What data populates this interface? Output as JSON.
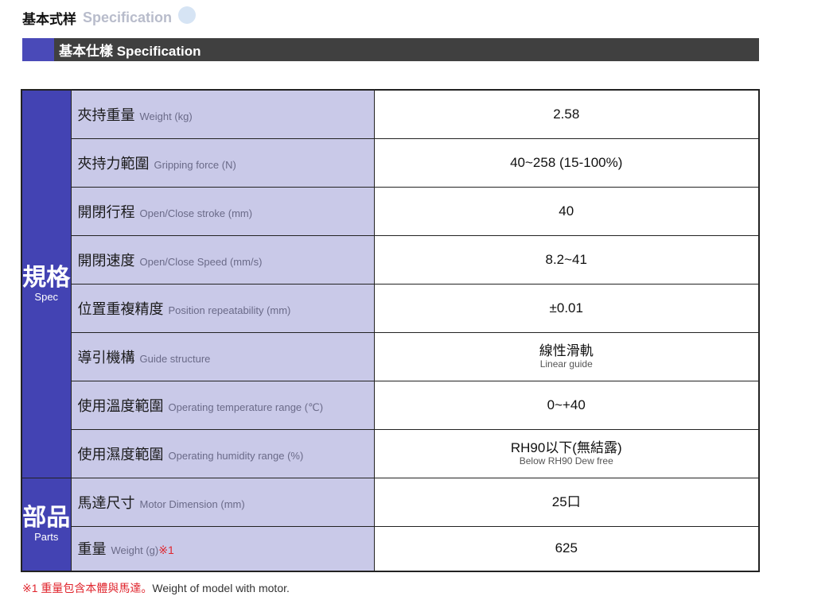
{
  "heading": {
    "zh": "基本式样",
    "en": "Specification"
  },
  "banner": {
    "title": "基本仕樣 Specification"
  },
  "sections": {
    "spec": {
      "zh": "規格",
      "en": "Spec"
    },
    "parts": {
      "zh": "部品",
      "en": "Parts"
    }
  },
  "rows": [
    {
      "label_zh": "夾持重量",
      "label_en": "Weight (kg)",
      "value": "2.58"
    },
    {
      "label_zh": "夾持力範圍",
      "label_en": "Gripping force (N)",
      "value": "40~258 (15-100%)"
    },
    {
      "label_zh": "開閉行程",
      "label_en": "Open/Close  stroke (mm)",
      "value": "40"
    },
    {
      "label_zh": "開閉速度",
      "label_en": "Open/Close Speed (mm/s)",
      "value": "8.2~41"
    },
    {
      "label_zh": "位置重複精度",
      "label_en": "Position repeatability (mm)",
      "value": "±0.01"
    },
    {
      "label_zh": "導引機構",
      "label_en": "Guide structure",
      "value": "線性滑軌",
      "value_sub": "Linear guide"
    },
    {
      "label_zh": "使用溫度範圍",
      "label_en": "Operating temperature range (℃)",
      "value": "0~+40"
    },
    {
      "label_zh": "使用濕度範圍",
      "label_en": "Operating humidity range (%)",
      "value": "RH90以下(無結露)",
      "value_sub": "Below RH90 Dew free"
    },
    {
      "label_zh": "馬達尺寸",
      "label_en": "Motor Dimension (mm)",
      "value": "25口"
    },
    {
      "label_zh": "重量",
      "label_en": "Weight (g)",
      "label_mark": "※1",
      "value": "625"
    }
  ],
  "footnote": {
    "zh": "※1 重量包含本體與馬達。",
    "en": "Weight of model with motor."
  },
  "colors": {
    "banner": "#404040",
    "accent": "#4343b3",
    "label_bg": "#c9c9e8",
    "mark": "#e0262e"
  }
}
